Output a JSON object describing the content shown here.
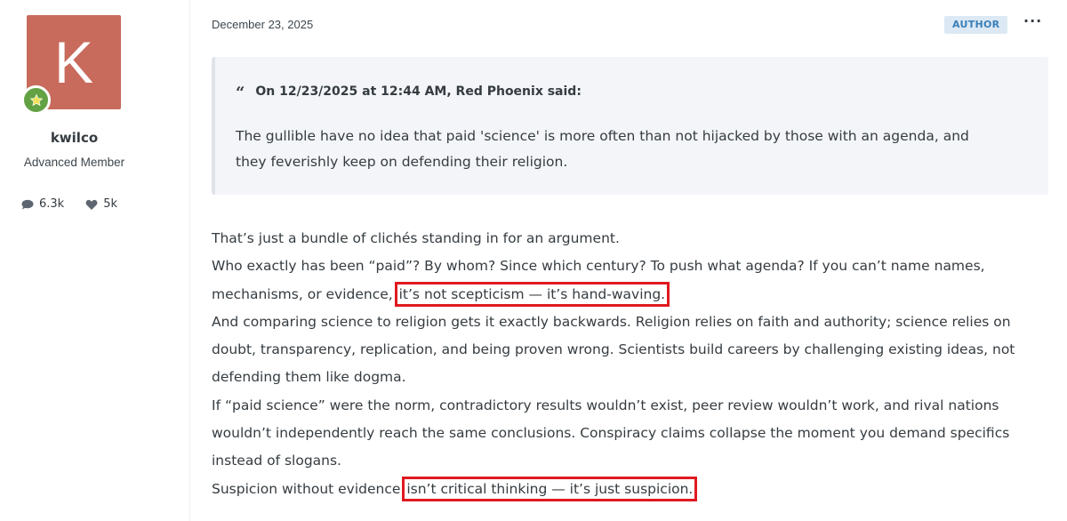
{
  "author": {
    "avatar_letter": "K",
    "avatar_color": "#c86b5c",
    "rank_icon": "star-rank-badge-icon",
    "username": "kwilco",
    "title": "Advanced Member",
    "stats": {
      "comments": "6.3k",
      "reactions": "5k"
    }
  },
  "post": {
    "date": "December 23, 2025",
    "author_badge": "AUTHOR",
    "more_label": "···",
    "quote": {
      "header": "On 12/23/2025 at 12:44 AM, Red Phoenix said:",
      "lines": [
        "The gullible have no idea that paid 'science' is more often than not hijacked by those with an agenda, and",
        "they feverishly keep on defending their religion."
      ]
    },
    "body": {
      "line1": "That’s just a bundle of clichés standing in for an argument.",
      "line2": "Who exactly has been “paid”? By whom? Since which century? To push what agenda? If you can’t name names,",
      "line3_pre": "mechanisms, or evidence, ",
      "line3_highlight": "it’s not scepticism — it’s hand-waving.",
      "line4": "And comparing science to religion gets it exactly backwards. Religion relies on faith and authority; science relies on",
      "line5": "doubt, transparency, replication, and being proven wrong. Scientists build careers by challenging existing ideas, not",
      "line6": "defending them like dogma.",
      "line7": "If “paid science” were the norm, contradictory results wouldn’t exist, peer review wouldn’t work, and rival nations",
      "line8": "wouldn’t independently reach the same conclusions. Conspiracy claims collapse the moment you demand specifics",
      "line9": "instead of slogans.",
      "line10_pre": "Suspicion without evidence ",
      "line10_highlight": "isn’t critical thinking — it’s just suspicion."
    },
    "highlight_color": "#e0191f"
  }
}
